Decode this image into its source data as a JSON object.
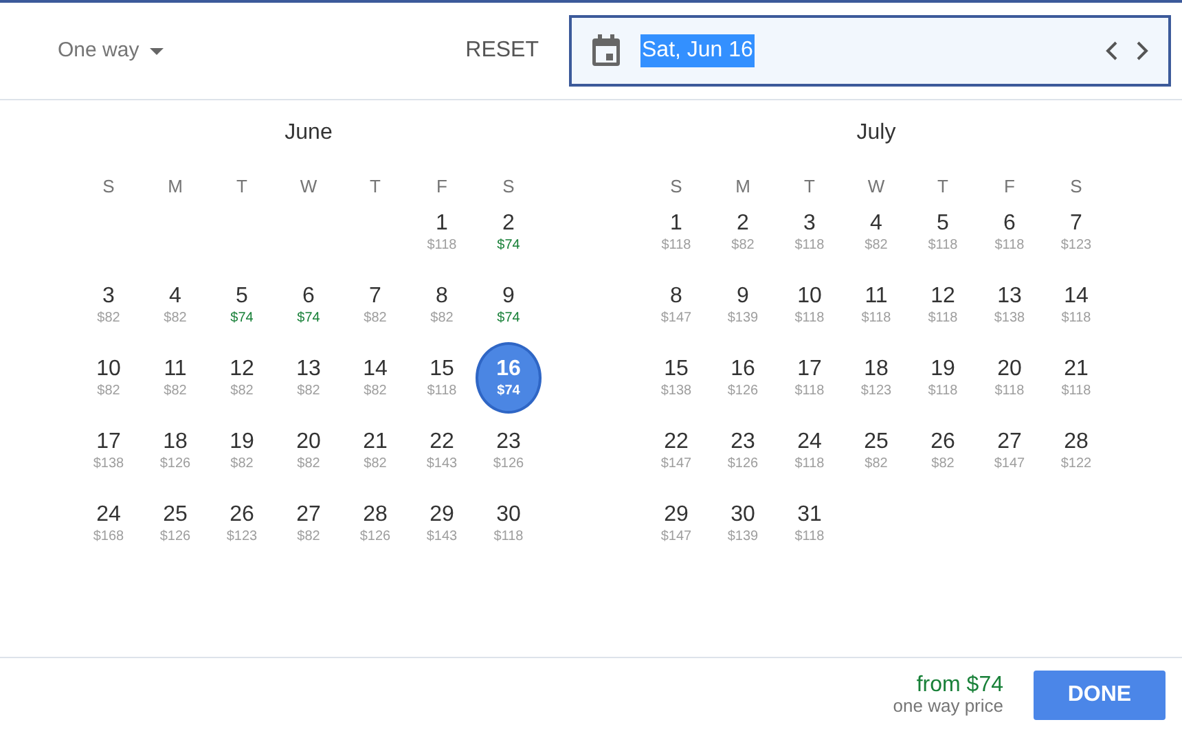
{
  "trip_type": {
    "label": "One way"
  },
  "reset_button": "RESET",
  "date_field": {
    "value": "Sat, Jun 16"
  },
  "months": [
    {
      "name": "June",
      "weekdays": [
        "S",
        "M",
        "T",
        "W",
        "T",
        "F",
        "S"
      ],
      "weeks": [
        [
          {
            "day": "1",
            "price": "$118",
            "lowest": false,
            "selected": false
          },
          {
            "day": "2",
            "price": "$74",
            "lowest": true,
            "selected": false
          }
        ],
        [
          {
            "day": "3",
            "price": "$82",
            "lowest": false,
            "selected": false
          },
          {
            "day": "4",
            "price": "$82",
            "lowest": false,
            "selected": false
          },
          {
            "day": "5",
            "price": "$74",
            "lowest": true,
            "selected": false
          },
          {
            "day": "6",
            "price": "$74",
            "lowest": true,
            "selected": false
          },
          {
            "day": "7",
            "price": "$82",
            "lowest": false,
            "selected": false
          },
          {
            "day": "8",
            "price": "$82",
            "lowest": false,
            "selected": false
          },
          {
            "day": "9",
            "price": "$74",
            "lowest": true,
            "selected": false
          }
        ],
        [
          {
            "day": "10",
            "price": "$82",
            "lowest": false,
            "selected": false
          },
          {
            "day": "11",
            "price": "$82",
            "lowest": false,
            "selected": false
          },
          {
            "day": "12",
            "price": "$82",
            "lowest": false,
            "selected": false
          },
          {
            "day": "13",
            "price": "$82",
            "lowest": false,
            "selected": false
          },
          {
            "day": "14",
            "price": "$82",
            "lowest": false,
            "selected": false
          },
          {
            "day": "15",
            "price": "$118",
            "lowest": false,
            "selected": false
          },
          {
            "day": "16",
            "price": "$74",
            "lowest": true,
            "selected": true
          }
        ],
        [
          {
            "day": "17",
            "price": "$138",
            "lowest": false,
            "selected": false
          },
          {
            "day": "18",
            "price": "$126",
            "lowest": false,
            "selected": false
          },
          {
            "day": "19",
            "price": "$82",
            "lowest": false,
            "selected": false
          },
          {
            "day": "20",
            "price": "$82",
            "lowest": false,
            "selected": false
          },
          {
            "day": "21",
            "price": "$82",
            "lowest": false,
            "selected": false
          },
          {
            "day": "22",
            "price": "$143",
            "lowest": false,
            "selected": false
          },
          {
            "day": "23",
            "price": "$126",
            "lowest": false,
            "selected": false
          }
        ],
        [
          {
            "day": "24",
            "price": "$168",
            "lowest": false,
            "selected": false
          },
          {
            "day": "25",
            "price": "$126",
            "lowest": false,
            "selected": false
          },
          {
            "day": "26",
            "price": "$123",
            "lowest": false,
            "selected": false
          },
          {
            "day": "27",
            "price": "$82",
            "lowest": false,
            "selected": false
          },
          {
            "day": "28",
            "price": "$126",
            "lowest": false,
            "selected": false
          },
          {
            "day": "29",
            "price": "$143",
            "lowest": false,
            "selected": false
          },
          {
            "day": "30",
            "price": "$118",
            "lowest": false,
            "selected": false
          }
        ]
      ]
    },
    {
      "name": "July",
      "weekdays": [
        "S",
        "M",
        "T",
        "W",
        "T",
        "F",
        "S"
      ],
      "weeks": [
        [
          {
            "day": "1",
            "price": "$118",
            "lowest": false,
            "selected": false
          },
          {
            "day": "2",
            "price": "$82",
            "lowest": false,
            "selected": false
          },
          {
            "day": "3",
            "price": "$118",
            "lowest": false,
            "selected": false
          },
          {
            "day": "4",
            "price": "$82",
            "lowest": false,
            "selected": false
          },
          {
            "day": "5",
            "price": "$118",
            "lowest": false,
            "selected": false
          },
          {
            "day": "6",
            "price": "$118",
            "lowest": false,
            "selected": false
          },
          {
            "day": "7",
            "price": "$123",
            "lowest": false,
            "selected": false
          }
        ],
        [
          {
            "day": "8",
            "price": "$147",
            "lowest": false,
            "selected": false
          },
          {
            "day": "9",
            "price": "$139",
            "lowest": false,
            "selected": false
          },
          {
            "day": "10",
            "price": "$118",
            "lowest": false,
            "selected": false
          },
          {
            "day": "11",
            "price": "$118",
            "lowest": false,
            "selected": false
          },
          {
            "day": "12",
            "price": "$118",
            "lowest": false,
            "selected": false
          },
          {
            "day": "13",
            "price": "$138",
            "lowest": false,
            "selected": false
          },
          {
            "day": "14",
            "price": "$118",
            "lowest": false,
            "selected": false
          }
        ],
        [
          {
            "day": "15",
            "price": "$138",
            "lowest": false,
            "selected": false
          },
          {
            "day": "16",
            "price": "$126",
            "lowest": false,
            "selected": false
          },
          {
            "day": "17",
            "price": "$118",
            "lowest": false,
            "selected": false
          },
          {
            "day": "18",
            "price": "$123",
            "lowest": false,
            "selected": false
          },
          {
            "day": "19",
            "price": "$118",
            "lowest": false,
            "selected": false
          },
          {
            "day": "20",
            "price": "$118",
            "lowest": false,
            "selected": false
          },
          {
            "day": "21",
            "price": "$118",
            "lowest": false,
            "selected": false
          }
        ],
        [
          {
            "day": "22",
            "price": "$147",
            "lowest": false,
            "selected": false
          },
          {
            "day": "23",
            "price": "$126",
            "lowest": false,
            "selected": false
          },
          {
            "day": "24",
            "price": "$118",
            "lowest": false,
            "selected": false
          },
          {
            "day": "25",
            "price": "$82",
            "lowest": false,
            "selected": false
          },
          {
            "day": "26",
            "price": "$82",
            "lowest": false,
            "selected": false
          },
          {
            "day": "27",
            "price": "$147",
            "lowest": false,
            "selected": false
          },
          {
            "day": "28",
            "price": "$122",
            "lowest": false,
            "selected": false
          }
        ],
        [
          {
            "day": "29",
            "price": "$147",
            "lowest": false,
            "selected": false
          },
          {
            "day": "30",
            "price": "$139",
            "lowest": false,
            "selected": false
          },
          {
            "day": "31",
            "price": "$118",
            "lowest": false,
            "selected": false
          }
        ]
      ]
    }
  ],
  "footer": {
    "price": "from $74",
    "price_note": "one way price",
    "done_button": "DONE"
  }
}
